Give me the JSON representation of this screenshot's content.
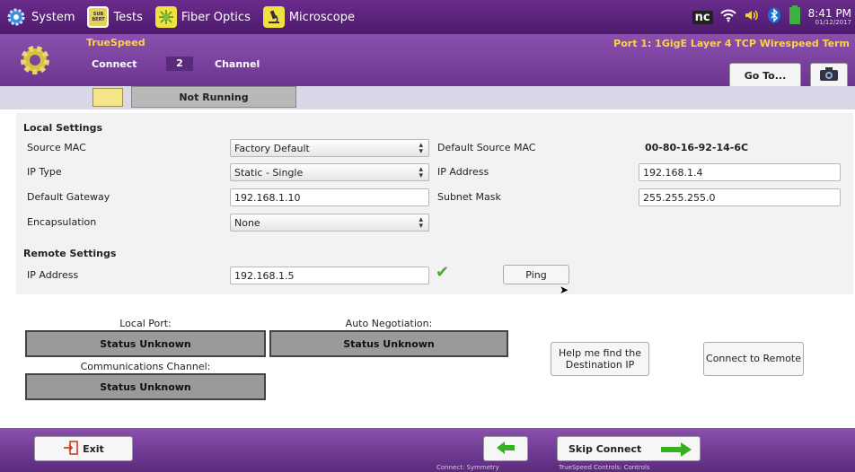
{
  "topbar": {
    "tabs": [
      {
        "label": "System",
        "icon": "gear-icon"
      },
      {
        "label": "Tests",
        "icon": "sub-bert-icon",
        "icon_text": "SUB BERT"
      },
      {
        "label": "Fiber Optics",
        "icon": "fiber-icon"
      },
      {
        "label": "Microscope",
        "icon": "microscope-icon"
      }
    ],
    "status_icons": [
      "nc-icon",
      "wifi-icon",
      "volume-icon",
      "bluetooth-icon",
      "battery-icon"
    ],
    "nc_label": "nc",
    "time": "8:41 PM",
    "date": "01/12/2017"
  },
  "header": {
    "app_title": "TrueSpeed",
    "nav_connect": "Connect",
    "nav_num": "2",
    "nav_channel": "Channel",
    "port_title": "Port 1: 1GigE Layer 4 TCP Wirespeed Term",
    "goto_label": "Go To..."
  },
  "run": {
    "status": "Not Running"
  },
  "local": {
    "title": "Local Settings",
    "source_mac_label": "Source MAC",
    "source_mac_value": "Factory Default",
    "default_mac_label": "Default Source MAC",
    "default_mac_value": "00-80-16-92-14-6C",
    "ip_type_label": "IP Type",
    "ip_type_value": "Static - Single",
    "ip_addr_label": "IP Address",
    "ip_addr_value": "192.168.1.4",
    "gateway_label": "Default Gateway",
    "gateway_value": "192.168.1.10",
    "subnet_label": "Subnet Mask",
    "subnet_value": "255.255.255.0",
    "encap_label": "Encapsulation",
    "encap_value": "None"
  },
  "remote": {
    "title": "Remote Settings",
    "ip_label": "IP Address",
    "ip_value": "192.168.1.5",
    "ping_label": "Ping"
  },
  "status": {
    "local_port_label": "Local Port:",
    "local_port_value": "Status Unknown",
    "auto_neg_label": "Auto Negotiation:",
    "auto_neg_value": "Status Unknown",
    "comm_label": "Communications Channel:",
    "comm_value": "Status Unknown",
    "help_label": "Help me find the Destination IP",
    "connect_label": "Connect to Remote"
  },
  "footer": {
    "exit_label": "Exit",
    "skip_label": "Skip Connect",
    "back_caption": "Connect: Symmetry",
    "skip_caption": "TrueSpeed Controls: Controls"
  }
}
